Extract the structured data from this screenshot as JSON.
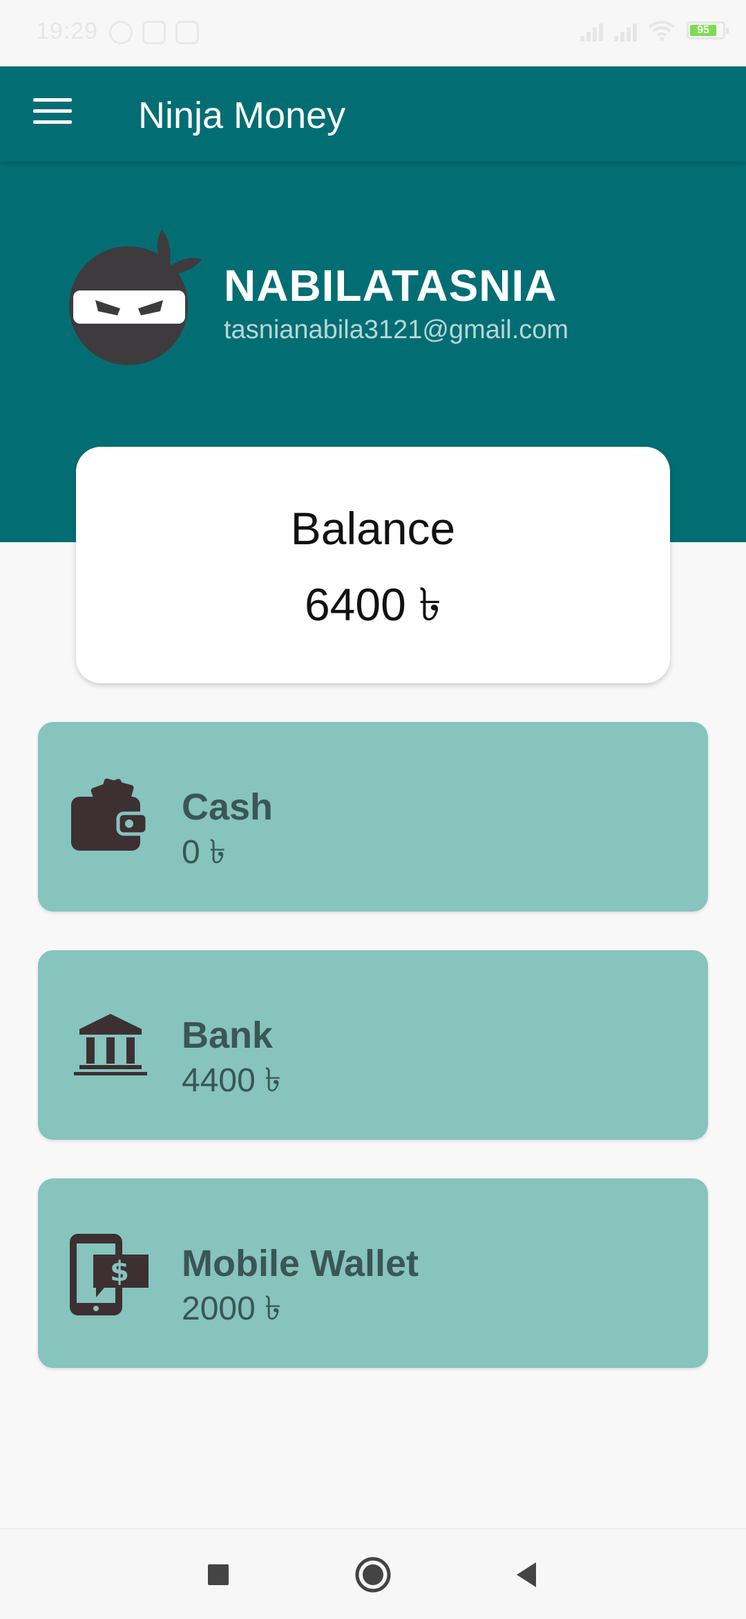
{
  "status_bar": {
    "time": "19:29",
    "battery": "95"
  },
  "appbar": {
    "title": "Ninja Money",
    "menu_icon": "hamburger-menu-icon"
  },
  "profile": {
    "name": "NABILATASNIA",
    "email": "tasnianabila3121@gmail.com",
    "avatar_icon": "ninja-avatar-icon"
  },
  "balance": {
    "label": "Balance",
    "value": "6400 ৳"
  },
  "accounts": [
    {
      "name": "Cash",
      "amount": "0 ৳",
      "icon": "wallet-icon"
    },
    {
      "name": "Bank",
      "amount": "4400 ৳",
      "icon": "bank-icon"
    },
    {
      "name": "Mobile Wallet",
      "amount": "2000 ৳",
      "icon": "mobile-wallet-icon"
    }
  ],
  "colors": {
    "primary": "#026e73",
    "card": "#86c4bd",
    "text_dark": "#3b5654"
  },
  "navbar": {
    "icons": [
      "recent-apps-icon",
      "home-icon",
      "back-icon"
    ]
  }
}
